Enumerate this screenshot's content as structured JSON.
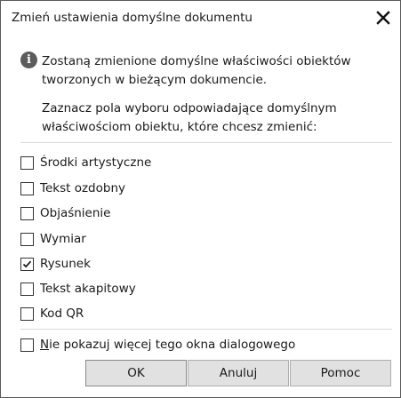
{
  "dialog": {
    "title": "Zmień ustawienia domyślne dokumentu",
    "info_line1": "Zostaną zmienione domyślne właściwości obiektów",
    "info_line2": "tworzonych w bieżącym dokumencie.",
    "instruction_line1": "Zaznacz pola wyboru odpowiadające domyślnym",
    "instruction_line2": "właściwościom obiektu, które chcesz zmienić:"
  },
  "options": [
    {
      "label": "Środki artystyczne",
      "checked": false
    },
    {
      "label": "Tekst ozdobny",
      "checked": false
    },
    {
      "label": "Objaśnienie",
      "checked": false
    },
    {
      "label": "Wymiar",
      "checked": false
    },
    {
      "label": "Rysunek",
      "checked": true
    },
    {
      "label": "Tekst akapitowy",
      "checked": false
    },
    {
      "label": "Kod QR",
      "checked": false
    }
  ],
  "dont_show": {
    "mnemonic": "N",
    "rest": "ie pokazuj więcej tego okna dialogowego",
    "checked": false
  },
  "buttons": {
    "ok": "OK",
    "cancel": "Anuluj",
    "help": "Pomoc"
  },
  "icons": {
    "info": "info-icon",
    "close": "close-icon",
    "check": "checkmark-icon"
  }
}
